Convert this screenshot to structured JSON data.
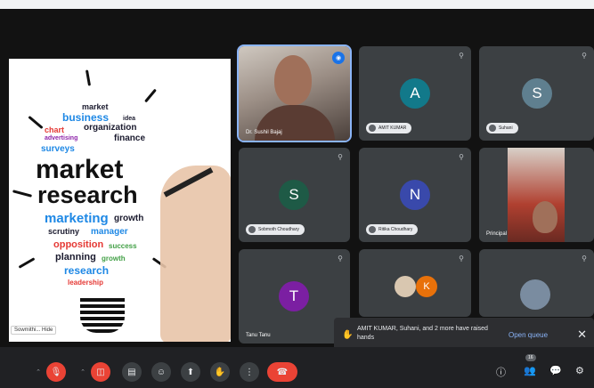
{
  "presentation": {
    "words": [
      {
        "text": "market",
        "color": "#1a1a2e",
        "size": 9
      },
      {
        "text": "business",
        "color": "#1e88e5",
        "size": 12
      },
      {
        "text": "idea",
        "color": "#1a1a2e",
        "size": 7
      },
      {
        "text": "organization",
        "color": "#1a1a2e",
        "size": 10
      },
      {
        "text": "chart",
        "color": "#e53935",
        "size": 9
      },
      {
        "text": "advertising",
        "color": "#8e24aa",
        "size": 7
      },
      {
        "text": "finance",
        "color": "#1a1a2e",
        "size": 10
      },
      {
        "text": "surveys",
        "color": "#1e88e5",
        "size": 10
      },
      {
        "text": "market",
        "color": "#111111",
        "size": 30
      },
      {
        "text": "research",
        "color": "#111111",
        "size": 27
      },
      {
        "text": "marketing",
        "color": "#1e88e5",
        "size": 15
      },
      {
        "text": "growth",
        "color": "#1a1a2e",
        "size": 10
      },
      {
        "text": "scrutiny",
        "color": "#1a1a2e",
        "size": 9
      },
      {
        "text": "manager",
        "color": "#1e88e5",
        "size": 10
      },
      {
        "text": "opposition",
        "color": "#e53935",
        "size": 11
      },
      {
        "text": "success",
        "color": "#43a047",
        "size": 8
      },
      {
        "text": "planning",
        "color": "#1a1a2e",
        "size": 11
      },
      {
        "text": "growth",
        "color": "#43a047",
        "size": 8
      },
      {
        "text": "research",
        "color": "#1e88e5",
        "size": 12
      },
      {
        "text": "leadership",
        "color": "#e53935",
        "size": 8
      }
    ],
    "tag": "Sowmithi... Hide"
  },
  "tiles": [
    {
      "name": "Dr. Sushil Bajaj",
      "kind": "video"
    },
    {
      "name": "AMIT KUMAR",
      "kind": "avatar",
      "letter": "A",
      "color": "#12798a"
    },
    {
      "name": "Suhani",
      "kind": "avatar",
      "letter": "S",
      "color": "#5f7f8f"
    },
    {
      "name": "Sobmoth Choudhary",
      "kind": "avatar",
      "letter": "S",
      "color": "#1e5a46"
    },
    {
      "name": "Ritika Choudhary",
      "kind": "avatar",
      "letter": "N",
      "color": "#3949ab"
    },
    {
      "name": "Principal",
      "kind": "video"
    },
    {
      "name": "Tanu Tanu",
      "kind": "avatar",
      "letter": "T",
      "color": "#7b1fa2"
    },
    {
      "name": "",
      "kind": "avatar-pair",
      "letter": "K",
      "color": "#e8710a"
    },
    {
      "name": "",
      "kind": "video"
    }
  ],
  "toast": {
    "message": "AMIT KUMAR, Suhani, and 2 more have raised hands",
    "link": "Open queue",
    "close": "✕"
  },
  "controls": {
    "participant_count": "16"
  }
}
